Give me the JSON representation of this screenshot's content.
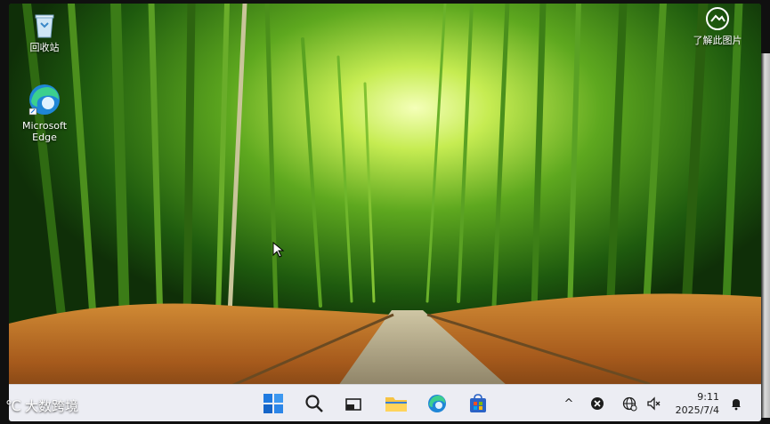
{
  "desktop": {
    "icons": [
      {
        "label": "回收站",
        "icon": "recycle-bin-icon"
      },
      {
        "label_line1": "Microsoft",
        "label_line2": "Edge",
        "icon": "edge-browser-icon"
      }
    ],
    "spotlight": {
      "label": "了解此图片",
      "icon": "camera-info-icon"
    },
    "wallpaper": "bamboo-forest-path"
  },
  "taskbar": {
    "apps": [
      {
        "icon": "windows-start-icon"
      },
      {
        "icon": "search-icon"
      },
      {
        "icon": "task-view-icon"
      },
      {
        "icon": "file-explorer-icon"
      },
      {
        "icon": "edge-browser-icon"
      },
      {
        "icon": "microsoft-store-icon"
      }
    ],
    "tray": {
      "overflow_glyph": "^",
      "icons": [
        "close-circle-icon",
        "network-globe-icon",
        "speaker-muted-icon"
      ]
    },
    "clock": {
      "time": "9:11",
      "date": "2025/7/4"
    },
    "notification_icon": "notification-bell-icon"
  },
  "overlay": {
    "watermark": "大数跨境"
  },
  "colors": {
    "taskbar_bg": "#ecedf3",
    "bamboo_green": "#3f8a1c",
    "grass_orange": "#b8691f",
    "start_blue": "#1f7ae0"
  }
}
